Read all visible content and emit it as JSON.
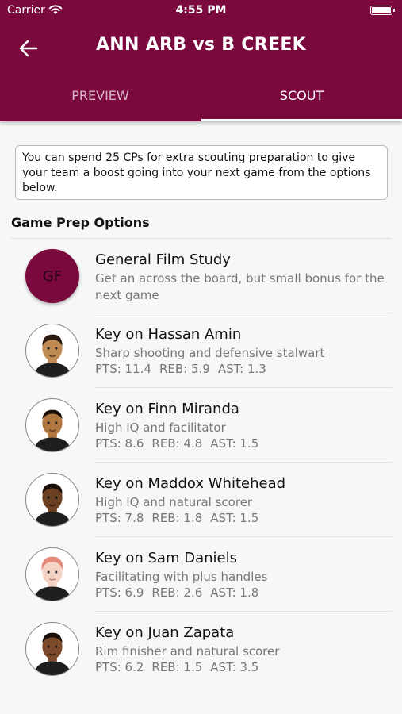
{
  "status_bar": {
    "carrier": "Carrier",
    "time": "4:55 PM"
  },
  "header": {
    "title": "ANN ARB vs B CREEK"
  },
  "tabs": [
    {
      "label": "PREVIEW",
      "active": false
    },
    {
      "label": "SCOUT",
      "active": true
    }
  ],
  "info": {
    "text": "You can spend 25 CPs for extra scouting preparation to give your team a boost going into your next game from the options below."
  },
  "section": {
    "title": "Game Prep Options"
  },
  "general": {
    "initials": "GF",
    "title": "General Film Study",
    "description": "Get an across the board, but small bonus for the next game"
  },
  "players": [
    {
      "title": "Key on Hassan Amin",
      "description": "Sharp shooting and defensive stalwart",
      "pts": "PTS: 11.4",
      "reb": "REB: 5.9",
      "ast": "AST: 1.3",
      "skin": "#c08a55",
      "hair": "#2a1a10"
    },
    {
      "title": "Key on Finn Miranda",
      "description": "High IQ and facilitator",
      "pts": "PTS: 8.6",
      "reb": "REB: 4.8",
      "ast": "AST: 1.5",
      "skin": "#b07840",
      "hair": "#1a1008"
    },
    {
      "title": "Key on Maddox Whitehead",
      "description": "High IQ and natural scorer",
      "pts": "PTS: 7.8",
      "reb": "REB: 1.8",
      "ast": "AST: 1.5",
      "skin": "#6a3f22",
      "hair": "#1a0f08"
    },
    {
      "title": "Key on Sam Daniels",
      "description": "Facilitating with plus handles",
      "pts": "PTS: 6.9",
      "reb": "REB: 2.6",
      "ast": "AST: 1.8",
      "skin": "#f4d3c4",
      "hair": "#e58a7a"
    },
    {
      "title": "Key on Juan Zapata",
      "description": "Rim finisher and natural scorer",
      "pts": "PTS: 6.2",
      "reb": "REB: 1.5",
      "ast": "AST: 3.5",
      "skin": "#7a4a2a",
      "hair": "#1a0f08"
    }
  ],
  "colors": {
    "brand": "#7a0a3e"
  }
}
